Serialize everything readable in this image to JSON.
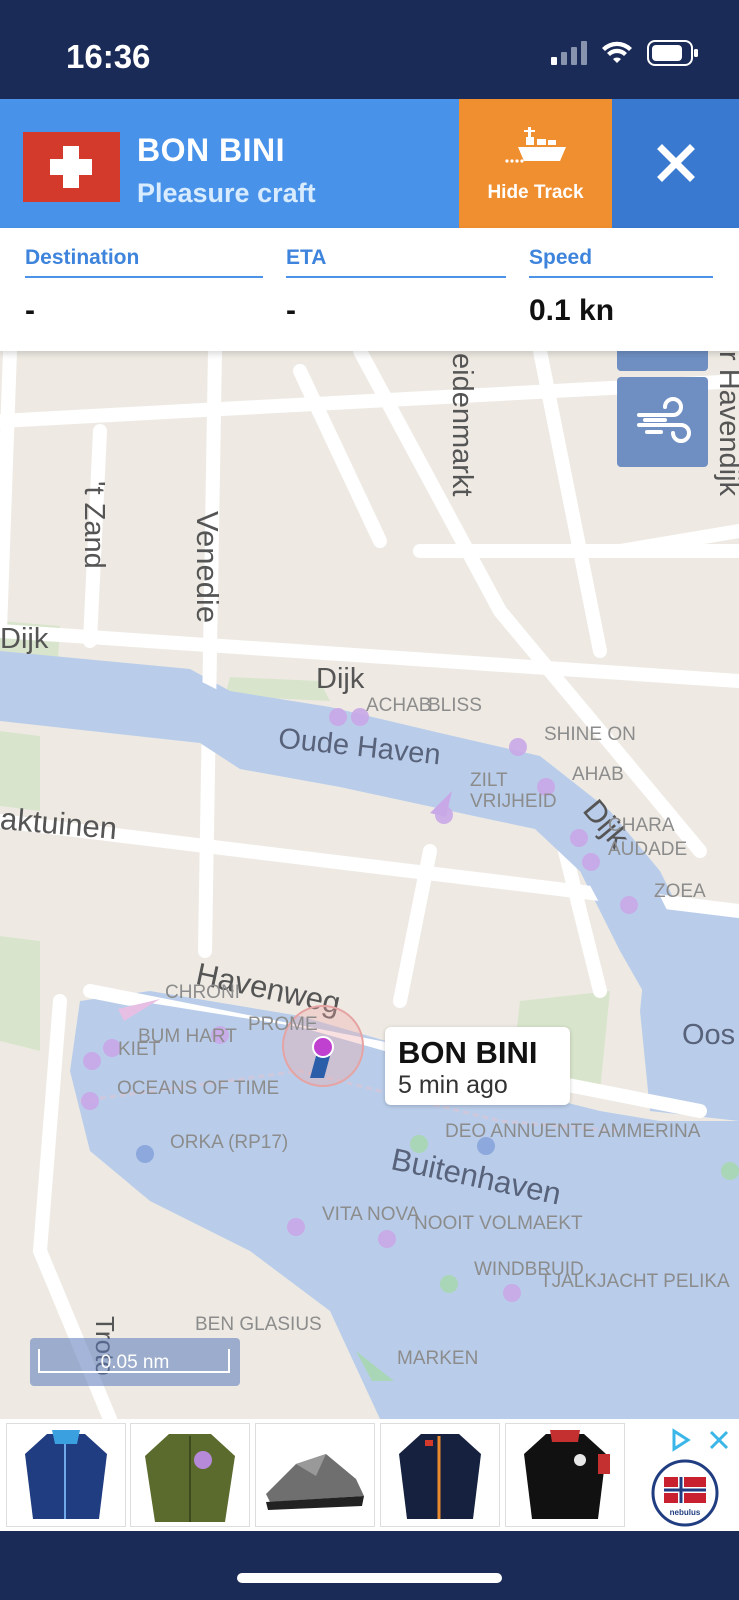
{
  "status_bar": {
    "time": "16:36"
  },
  "vessel": {
    "name": "BON BINI",
    "type": "Pleasure craft",
    "flag": "Switzerland"
  },
  "header_actions": {
    "hide_track_label": "Hide Track"
  },
  "info": [
    {
      "label": "Destination",
      "value": "-"
    },
    {
      "label": "ETA",
      "value": "-"
    },
    {
      "label": "Speed",
      "value": "0.1 kn"
    }
  ],
  "callout": {
    "name": "BON BINI",
    "time": "5 min ago"
  },
  "map": {
    "streets": [
      "'t Zand",
      "Venedie",
      "eidenmarkt",
      "Dijk",
      "Dijk",
      "Oude Haven",
      "aktuinen",
      "Dijk",
      "Havenweg",
      "Buitenhaven",
      "r Havendijk",
      "Oos",
      "Troto"
    ],
    "vessels": [
      "ACHAB",
      "BLISS",
      "SHINE ON",
      "AHAB",
      "ZILT",
      "VRIJHEID",
      "CHARA",
      "AUDADE",
      "ZOEA",
      "CHRONI",
      "PROME",
      "BUM HART",
      "KIET",
      "OCEANS OF TIME",
      "ORKA (RP17)",
      "DEO ANNUENTE",
      "AMMERINA",
      "VITA NOVA",
      "NOOIT VOLMAEKT",
      "WINDBRUID",
      "TJALKJACHT PELIKA",
      "BEN GLASIUS",
      "MARKEN"
    ],
    "scale": "0.05 nm"
  },
  "colors": {
    "header": "#4893e9",
    "hide_track": "#f08f2f",
    "close": "#397ad0",
    "water": "#b9cdea",
    "status_bar": "#1b2b58"
  },
  "ad": {
    "brand": "nebulus"
  }
}
